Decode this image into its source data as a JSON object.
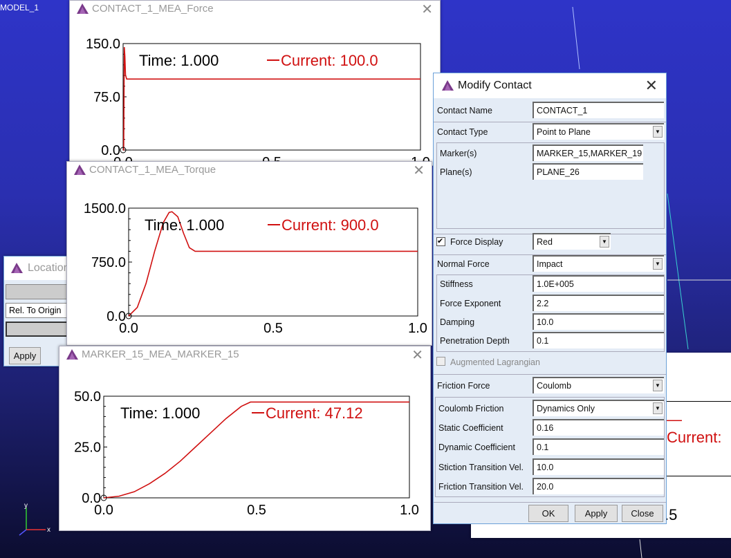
{
  "viewport": {
    "model_label": "MODEL_1",
    "axis_y": "y",
    "axis_x": "x"
  },
  "background_plot": {
    "current_label": "Current:",
    "tick": ".5"
  },
  "plots": [
    {
      "title": "CONTACT_1_MEA_Force",
      "time_label": "Time:",
      "time_value": "1.000",
      "current_label": "Current:",
      "current_value": "100.0",
      "chart_data": {
        "type": "line",
        "xlim": [
          0,
          1
        ],
        "ylim": [
          0,
          150
        ],
        "x_ticks": [
          "0.0",
          "0.5",
          "1.0"
        ],
        "y_ticks": [
          "0.0",
          "75.0",
          "150.0"
        ],
        "color": "#d01010",
        "x": [
          0,
          0.002,
          0.004,
          0.006,
          0.008,
          0.012,
          1
        ],
        "y": [
          0,
          0,
          145,
          132,
          106,
          100,
          100
        ]
      }
    },
    {
      "title": "CONTACT_1_MEA_Torque",
      "time_label": "Time:",
      "time_value": "1.000",
      "current_label": "Current:",
      "current_value": "900.0",
      "chart_data": {
        "type": "line",
        "xlim": [
          0,
          1
        ],
        "ylim": [
          0,
          1500
        ],
        "x_ticks": [
          "0.0",
          "0.5",
          "1.0"
        ],
        "y_ticks": [
          "0.0",
          "750.0",
          "1500.0"
        ],
        "color": "#d01010",
        "x": [
          0,
          0.03,
          0.06,
          0.09,
          0.12,
          0.14,
          0.15,
          0.17,
          0.19,
          0.21,
          0.23,
          1
        ],
        "y": [
          0,
          120,
          450,
          900,
          1300,
          1440,
          1450,
          1380,
          1150,
          950,
          900,
          900
        ]
      }
    },
    {
      "title": "MARKER_15_MEA_MARKER_15",
      "time_label": "Time:",
      "time_value": "1.000",
      "current_label": "Current:",
      "current_value": "47.12",
      "chart_data": {
        "type": "line",
        "xlim": [
          0,
          1
        ],
        "ylim": [
          0,
          50
        ],
        "x_ticks": [
          "0.0",
          "0.5",
          "1.0"
        ],
        "y_ticks": [
          "0.0",
          "25.0",
          "50.0"
        ],
        "color": "#d01010",
        "x": [
          0,
          0.05,
          0.1,
          0.15,
          0.2,
          0.25,
          0.3,
          0.35,
          0.4,
          0.45,
          0.48,
          1
        ],
        "y": [
          0,
          0.8,
          3,
          7,
          12,
          18,
          25,
          32,
          39,
          45,
          47.12,
          47.12
        ]
      }
    }
  ],
  "location": {
    "title": "Location",
    "rel_value": "Rel. To Origin",
    "apply": "Apply"
  },
  "dialog": {
    "title": "Modify Contact",
    "contact_name": {
      "label": "Contact Name",
      "value": "CONTACT_1"
    },
    "contact_type": {
      "label": "Contact Type",
      "value": "Point to Plane"
    },
    "markers": {
      "label": "Marker(s)",
      "value": "MARKER_15,MARKER_19"
    },
    "planes": {
      "label": "Plane(s)",
      "value": "PLANE_26"
    },
    "force_display": {
      "label": "Force Display",
      "checked": true,
      "value": "Red"
    },
    "normal_force": {
      "label": "Normal Force",
      "value": "Impact"
    },
    "stiffness": {
      "label": "Stiffness",
      "value": "1.0E+005"
    },
    "force_exponent": {
      "label": "Force Exponent",
      "value": "2.2"
    },
    "damping": {
      "label": "Damping",
      "value": "10.0"
    },
    "penetration_depth": {
      "label": "Penetration Depth",
      "value": "0.1"
    },
    "augmented": {
      "label": "Augmented Lagrangian",
      "checked": false
    },
    "friction_force": {
      "label": "Friction Force",
      "value": "Coulomb"
    },
    "coulomb_friction": {
      "label": "Coulomb Friction",
      "value": "Dynamics Only"
    },
    "static_coef": {
      "label": "Static Coefficient",
      "value": "0.16"
    },
    "dynamic_coef": {
      "label": "Dynamic Coefficient",
      "value": "0.1"
    },
    "stiction_vel": {
      "label": "Stiction Transition Vel.",
      "value": "10.0"
    },
    "friction_vel": {
      "label": "Friction Transition Vel.",
      "value": "20.0"
    },
    "ok": "OK",
    "apply": "Apply",
    "close": "Close"
  }
}
